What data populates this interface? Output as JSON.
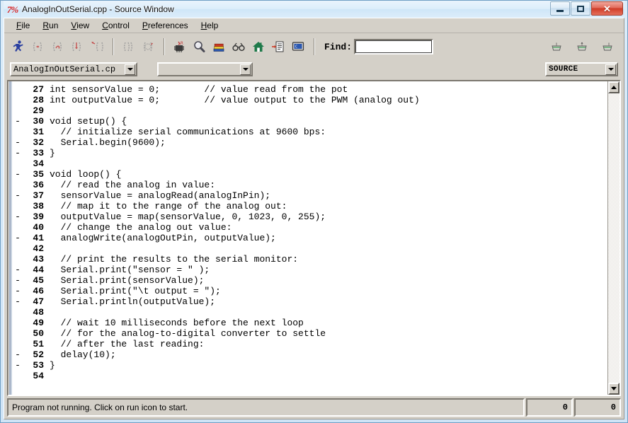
{
  "window": {
    "logo_glyph": "7%",
    "title": "AnalogInOutSerial.cpp - Source Window",
    "minimize_label": "",
    "maximize_label": "",
    "close_label": "✕"
  },
  "menu": [
    {
      "label": "File",
      "accel": "F"
    },
    {
      "label": "Run",
      "accel": "R"
    },
    {
      "label": "View",
      "accel": "V"
    },
    {
      "label": "Control",
      "accel": "C"
    },
    {
      "label": "Preferences",
      "accel": "P"
    },
    {
      "label": "Help",
      "accel": "H"
    }
  ],
  "toolbar": {
    "buttons": [
      {
        "name": "run-icon",
        "title": "Run",
        "enabled": true
      },
      {
        "name": "continue-icon",
        "title": "Continue",
        "enabled": false
      },
      {
        "name": "step-over-icon",
        "title": "Step Over",
        "enabled": false
      },
      {
        "name": "step-into-icon",
        "title": "Step Into",
        "enabled": false
      },
      {
        "name": "finish-function-icon",
        "title": "Finish Function",
        "enabled": false
      },
      {
        "name": "terminate-icon",
        "title": "Terminate Execution",
        "enabled": false
      },
      {
        "name": "breakpoint-icon",
        "title": "Toggle Breakpoint",
        "enabled": false
      },
      {
        "name": "chip-icon",
        "title": "Build",
        "enabled": true
      },
      {
        "name": "magnifier-icon",
        "title": "Find",
        "enabled": true
      },
      {
        "name": "books-icon",
        "title": "Library",
        "enabled": true
      },
      {
        "name": "binoculars-icon",
        "title": "Variables",
        "enabled": true
      },
      {
        "name": "house-icon",
        "title": "Home",
        "enabled": true
      },
      {
        "name": "document-arrow-icon",
        "title": "Go To Definition",
        "enabled": true
      },
      {
        "name": "monitor-icon",
        "title": "Display",
        "enabled": true
      }
    ],
    "right_buttons": [
      {
        "name": "basket-icon-1",
        "title": "Basket"
      },
      {
        "name": "basket-icon-2",
        "title": "Basket"
      },
      {
        "name": "basket-icon-3",
        "title": "Basket"
      }
    ],
    "find_label": "Find:",
    "find_value": "",
    "find_placeholder": ""
  },
  "selectors": {
    "file_value": "AnalogInOutSerial.cp",
    "function_value": "",
    "source_value": "SOURCE"
  },
  "editor": {
    "first_line": 27,
    "lines": [
      {
        "n": 27,
        "mark": "",
        "text": "int sensorValue = 0;        // value read from the pot"
      },
      {
        "n": 28,
        "mark": "",
        "text": "int outputValue = 0;        // value output to the PWM (analog out)"
      },
      {
        "n": 29,
        "mark": "",
        "text": ""
      },
      {
        "n": 30,
        "mark": "-",
        "text": "void setup() {"
      },
      {
        "n": 31,
        "mark": "",
        "text": "  // initialize serial communications at 9600 bps:"
      },
      {
        "n": 32,
        "mark": "-",
        "text": "  Serial.begin(9600);"
      },
      {
        "n": 33,
        "mark": "-",
        "text": "}"
      },
      {
        "n": 34,
        "mark": "",
        "text": ""
      },
      {
        "n": 35,
        "mark": "-",
        "text": "void loop() {"
      },
      {
        "n": 36,
        "mark": "",
        "text": "  // read the analog in value:"
      },
      {
        "n": 37,
        "mark": "-",
        "text": "  sensorValue = analogRead(analogInPin);"
      },
      {
        "n": 38,
        "mark": "",
        "text": "  // map it to the range of the analog out:"
      },
      {
        "n": 39,
        "mark": "-",
        "text": "  outputValue = map(sensorValue, 0, 1023, 0, 255);"
      },
      {
        "n": 40,
        "mark": "",
        "text": "  // change the analog out value:"
      },
      {
        "n": 41,
        "mark": "-",
        "text": "  analogWrite(analogOutPin, outputValue);"
      },
      {
        "n": 42,
        "mark": "",
        "text": ""
      },
      {
        "n": 43,
        "mark": "",
        "text": "  // print the results to the serial monitor:"
      },
      {
        "n": 44,
        "mark": "-",
        "text": "  Serial.print(\"sensor = \" );"
      },
      {
        "n": 45,
        "mark": "-",
        "text": "  Serial.print(sensorValue);"
      },
      {
        "n": 46,
        "mark": "-",
        "text": "  Serial.print(\"\\t output = \");"
      },
      {
        "n": 47,
        "mark": "-",
        "text": "  Serial.println(outputValue);"
      },
      {
        "n": 48,
        "mark": "",
        "text": ""
      },
      {
        "n": 49,
        "mark": "",
        "text": "  // wait 10 milliseconds before the next loop"
      },
      {
        "n": 50,
        "mark": "",
        "text": "  // for the analog-to-digital converter to settle"
      },
      {
        "n": 51,
        "mark": "",
        "text": "  // after the last reading:"
      },
      {
        "n": 52,
        "mark": "-",
        "text": "  delay(10);"
      },
      {
        "n": 53,
        "mark": "-",
        "text": "}"
      },
      {
        "n": 54,
        "mark": "",
        "text": ""
      }
    ]
  },
  "statusbar": {
    "message": "Program not running. Click on run icon to start.",
    "num1": "0",
    "num2": "0"
  },
  "colors": {
    "accent_blue": "#2a3fa0",
    "close_red": "#cf3b26",
    "client_grey": "#d4d0c8",
    "editor_bg": "#ffffff",
    "logo_red": "#d92020"
  }
}
